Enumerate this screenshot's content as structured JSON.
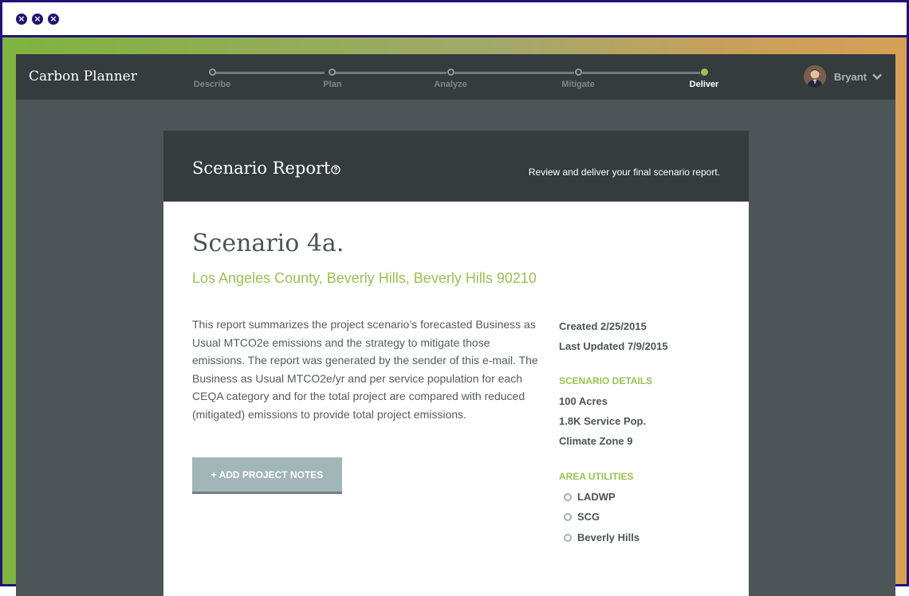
{
  "window": {
    "controls": [
      "close",
      "minimize",
      "zoom"
    ]
  },
  "app": {
    "brand": "Carbon Planner",
    "steps": [
      {
        "label": "Describe",
        "active": false
      },
      {
        "label": "Plan",
        "active": false
      },
      {
        "label": "Analyze",
        "active": false
      },
      {
        "label": "Mitigate",
        "active": false
      },
      {
        "label": "Deliver",
        "active": true
      }
    ],
    "user": {
      "name": "Bryant",
      "avatar_icon": "user-avatar"
    }
  },
  "report": {
    "title": "Scenario Report",
    "subtitle": "Review and deliver your final scenario report.",
    "scenario_name": "Scenario 4a.",
    "location": "Los Angeles County, Beverly Hills, Beverly Hills 90210",
    "summary": "This report summarizes the project scenario’s forecasted Business as Usual MTCO2e emissions and the strategy to mitigate those emissions. The report was generated by the sender of this e-mail. The Business as Usual MTCO2e/yr and per service population for each CEQA category and for the total project are compared with reduced (mitigated) emissions to provide total project emissions.",
    "notes_button": "+ ADD PROJECT NOTES",
    "created": "Created 2/25/2015",
    "updated": "Last Updated 7/9/2015",
    "details_heading": "SCENARIO DETAILS",
    "details": [
      "100 Acres",
      "1.8K Service Pop.",
      "Climate Zone 9"
    ],
    "utilities_heading": "AREA UTILITIES",
    "utilities": [
      "LADWP",
      "SCG",
      "Beverly Hills"
    ]
  },
  "colors": {
    "accent": "#9bc153",
    "nav_bg": "#353c3e",
    "page_bg": "#4c5658"
  }
}
